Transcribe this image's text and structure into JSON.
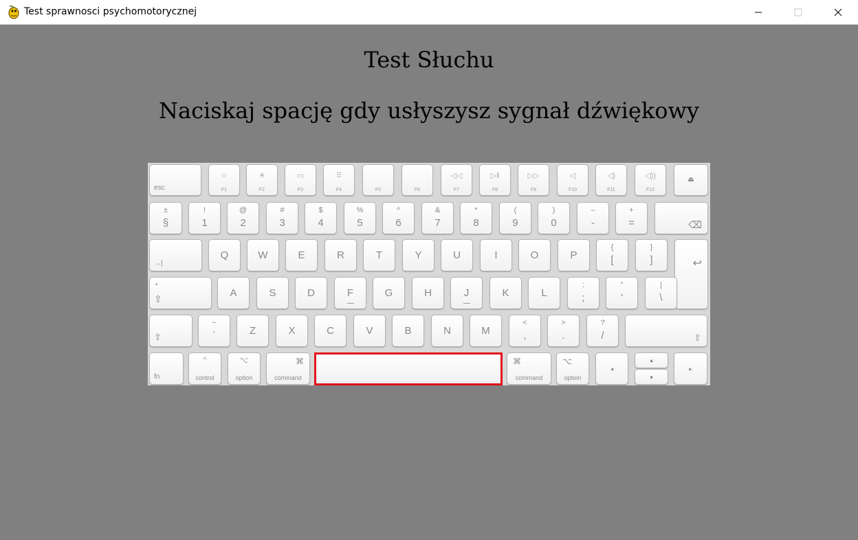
{
  "window": {
    "title": "Test sprawnosci psychomotorycznej",
    "app_icon": "pygame-snake-icon",
    "controls": [
      "minimize-icon",
      "maximize-icon",
      "close-icon"
    ]
  },
  "screen": {
    "title": "Test Słuchu",
    "instruction": "Naciskaj spację gdy usłyszysz sygnał dźwiękowy"
  },
  "keyboard": {
    "fn_row": {
      "esc": "esc",
      "f1": "F1",
      "f2": "F2",
      "f3": "F3",
      "f4": "F4",
      "f5": "F5",
      "f6": "F6",
      "f7": "F7",
      "f8": "F8",
      "f9": "F9",
      "f10": "F10",
      "f11": "F11",
      "f12": "F12",
      "eject": "⏏"
    },
    "number_row": {
      "sect_top": "±",
      "sect": "§",
      "k1_top": "!",
      "k1": "1",
      "k2_top": "@",
      "k2": "2",
      "k3_top": "#",
      "k3": "3",
      "k4_top": "$",
      "k4": "4",
      "k5_top": "%",
      "k5": "5",
      "k6_top": "^",
      "k6": "6",
      "k7_top": "&",
      "k7": "7",
      "k8_top": "*",
      "k8": "8",
      "k9_top": "(",
      "k9": "9",
      "k0_top": ")",
      "k0": "0",
      "minus_top": "–",
      "minus": "-",
      "equal_top": "+",
      "equal": "=",
      "backspace": "⌫"
    },
    "qwerty_row": {
      "tab": "→|",
      "keys": [
        "Q",
        "W",
        "E",
        "R",
        "T",
        "Y",
        "U",
        "I",
        "O",
        "P"
      ],
      "lbrace_top": "{",
      "lbrace": "[",
      "rbrace_top": "}",
      "rbrace": "]",
      "enter": "↩"
    },
    "home_row": {
      "caps_dot": "•",
      "caps": "⇪",
      "keys": [
        "A",
        "S",
        "D",
        "F",
        "G",
        "H",
        "J",
        "K",
        "L"
      ],
      "semi_top": ":",
      "semi": ";",
      "quote_top": "\"",
      "quote": "'",
      "pipe_top": "|",
      "pipe": "\\"
    },
    "shift_row": {
      "lshift": "⇧",
      "tilde_top": "~",
      "tilde": "`",
      "keys": [
        "Z",
        "X",
        "C",
        "V",
        "B",
        "N",
        "M"
      ],
      "lt_top": "<",
      "lt": ",",
      "gt_top": ">",
      "gt": ".",
      "q_top": "?",
      "q": "/",
      "rshift": "⇧"
    },
    "bottom_row": {
      "fn": "fn",
      "control_sym": "^",
      "control": "control",
      "option_sym": "⌥",
      "option": "option",
      "command_sym": "⌘",
      "command": "command",
      "r_command_sym": "⌘",
      "r_command": "command",
      "r_option_sym": "⌥",
      "r_option": "option",
      "left": "◂",
      "up": "▴",
      "down": "▾",
      "right": "▸"
    }
  },
  "colors": {
    "background": "#808080",
    "highlight": "#e3141b"
  }
}
